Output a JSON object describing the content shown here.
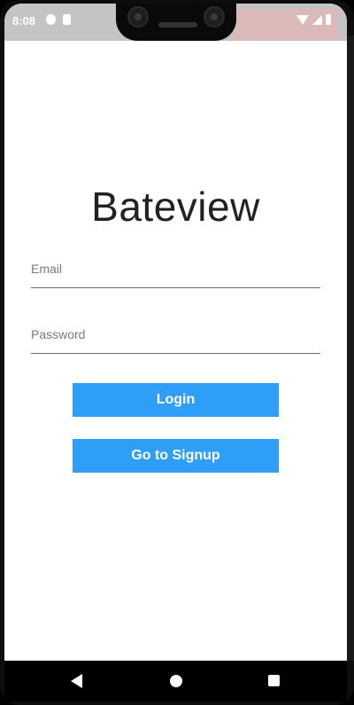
{
  "status_bar": {
    "time": "8:08",
    "left_icons": [
      "app-notification-icon",
      "sd-card-icon"
    ],
    "right_icons": [
      "wifi-icon",
      "signal-icon",
      "battery-icon"
    ]
  },
  "app": {
    "title": "Bateview",
    "email_placeholder": "Email",
    "password_placeholder": "Password",
    "login_label": "Login",
    "signup_label": "Go to Signup",
    "accent_color": "#2f9ef7"
  },
  "nav_bar": {
    "icons": [
      "back-icon",
      "home-icon",
      "recents-icon"
    ]
  }
}
